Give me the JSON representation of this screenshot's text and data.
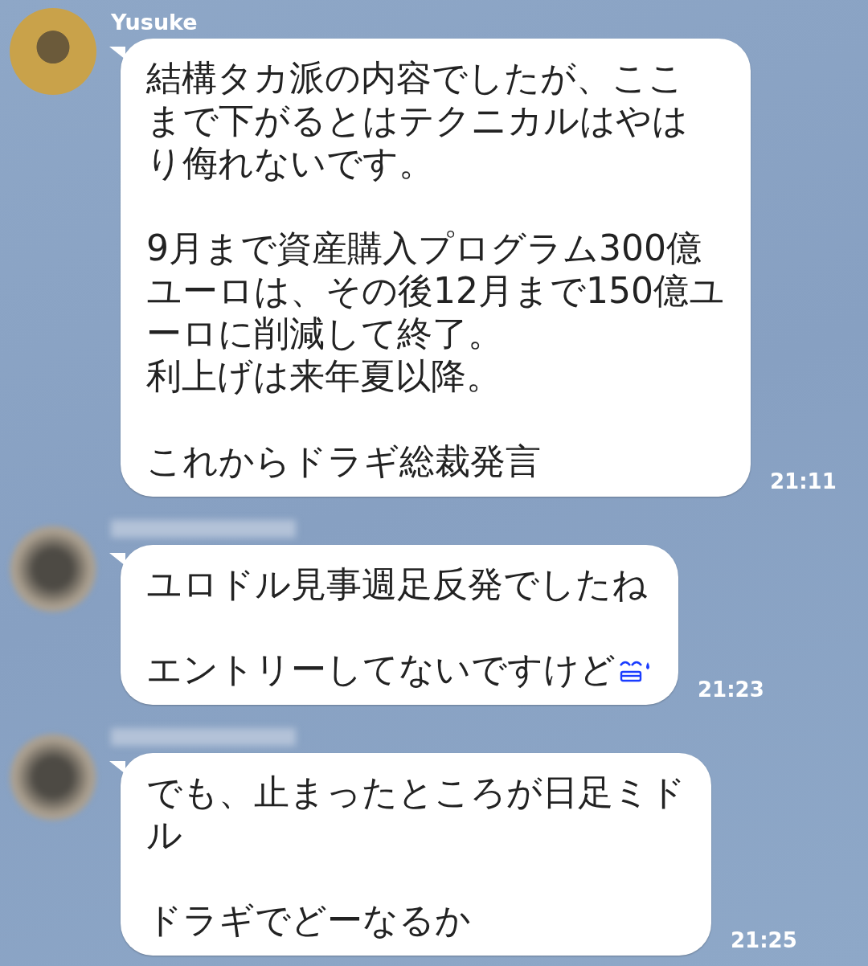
{
  "messages": [
    {
      "sender": {
        "name": "Yusuke",
        "name_blurred": false,
        "avatar_blurred": false
      },
      "paragraphs": [
        [
          "結構タカ派の内容でしたが、ここ",
          "まで下がるとはテクニカルはやは",
          "り侮れないです。"
        ],
        [
          "9月まで資産購入プログラム300億",
          "ユーロは、その後12月まで150億ユ",
          "ーロに削減して終了。",
          "利上げは来年夏以降。"
        ],
        [
          "これからドラギ総裁発言"
        ]
      ],
      "emoji": false,
      "time": "21:11"
    },
    {
      "sender": {
        "name_blurred": true,
        "avatar_blurred": true
      },
      "paragraphs": [
        [
          "ユロドル見事週足反発でしたね"
        ],
        [
          "エントリーしてないですけど"
        ]
      ],
      "emoji": true,
      "time": "21:23"
    },
    {
      "sender": {
        "name_blurred": true,
        "avatar_blurred": true
      },
      "paragraphs": [
        [
          "でも、止まったところが日足ミド",
          "ル"
        ],
        [
          "ドラギでどーなるか"
        ]
      ],
      "emoji": false,
      "time": "21:25"
    }
  ]
}
